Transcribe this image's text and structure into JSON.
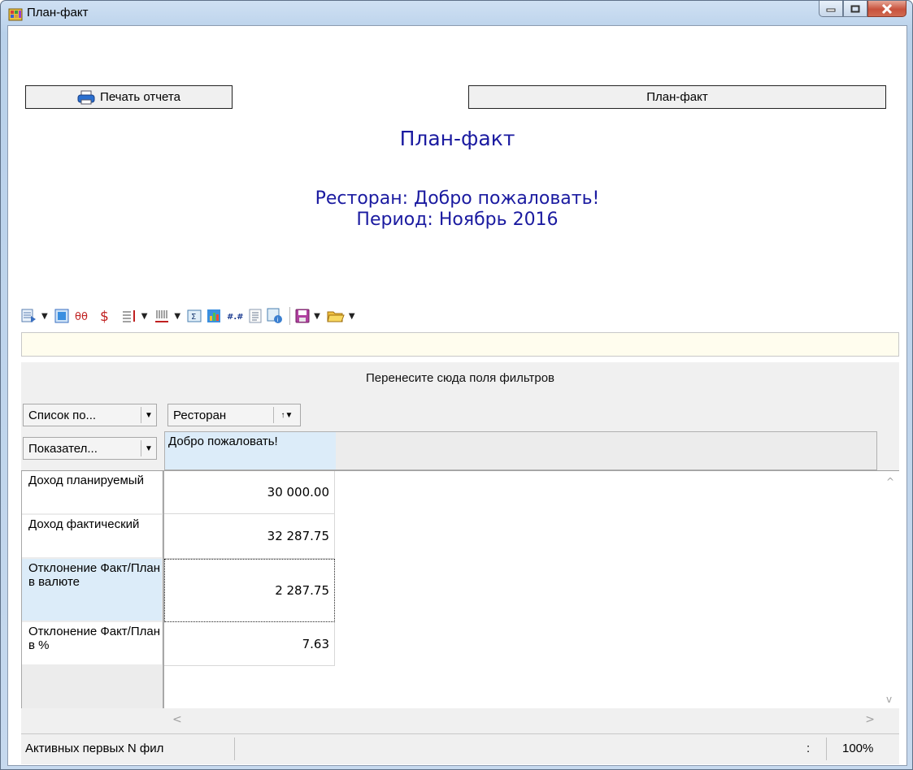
{
  "window": {
    "title": "План-факт"
  },
  "buttons": {
    "print_label": "Печать отчета",
    "report_label": "План-факт"
  },
  "report": {
    "title": "План-факт",
    "restaurant_line": "Ресторан: Добро пожаловать!",
    "period_line": "Период: Ноябрь 2016"
  },
  "toolbar": {
    "icons": [
      "field-list-icon",
      "layout-icon",
      "hide-zeros-icon",
      "currency-icon",
      "sort-rows-icon",
      "sort-columns-icon",
      "totals-icon",
      "chart-icon",
      "number-format-icon",
      "text-format-icon",
      "info-icon",
      "save-icon",
      "open-icon"
    ]
  },
  "pivot": {
    "filter_placeholder": "Перенесите сюда поля фильтров",
    "fields_list_button": "Список по...",
    "column_field": "Ресторан",
    "data_field": "Показател...",
    "column_header": "Добро пожаловать!",
    "rows": [
      {
        "label": "Доход планируемый",
        "value": "30 000.00"
      },
      {
        "label": "Доход фактический",
        "value": "32 287.75"
      },
      {
        "label": "Отклонение Факт/План в валюте",
        "value": "2 287.75"
      },
      {
        "label": "Отклонение Факт/План в %",
        "value": "7.63"
      }
    ]
  },
  "status": {
    "left": "Активных первых N фил",
    "mid": ":",
    "zoom": "100%"
  },
  "colors": {
    "accent": "#1a1aa0",
    "selection": "#dcecf9",
    "yellow": "#fffdee"
  }
}
